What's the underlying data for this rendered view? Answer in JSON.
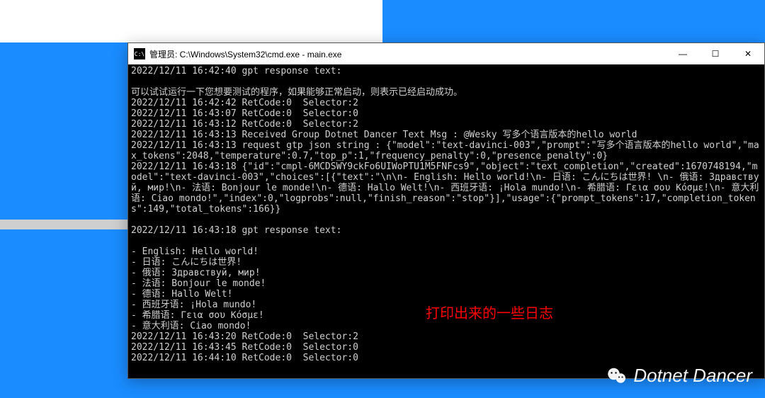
{
  "window": {
    "icon_text": "C:\\",
    "title": "管理员: C:\\Windows\\System32\\cmd.exe - main.exe",
    "controls": {
      "minimize": "—",
      "maximize": "☐",
      "close": "✕"
    }
  },
  "terminal": {
    "lines": [
      "2022/12/11 16:42:40 gpt response text:",
      "",
      "可以试试运行一下您想要测试的程序，如果能够正常启动，则表示已经启动成功。",
      "2022/12/11 16:42:42 RetCode:0  Selector:2",
      "2022/12/11 16:43:07 RetCode:0  Selector:0",
      "2022/12/11 16:43:12 RetCode:0  Selector:2",
      "2022/12/11 16:43:13 Received Group Dotnet Dancer Text Msg : @Wesky 写多个语言版本的hello world",
      "2022/12/11 16:43:13 request gtp json string : {\"model\":\"text-davinci-003\",\"prompt\":\"写多个语言版本的hello world\",\"max_tokens\":2048,\"temperature\":0.7,\"top_p\":1,\"frequency_penalty\":0,\"presence_penalty\":0}",
      "2022/12/11 16:43:18 {\"id\":\"cmpl-6MCDSWY9ckFo6UIWoPTU1M5FNFcs9\",\"object\":\"text_completion\",\"created\":1670748194,\"model\":\"text-davinci-003\",\"choices\":[{\"text\":\"\\n\\n- English: Hello world!\\n- 日语: こんにちは世界! \\n- 俄语: Здравствуй, мир!\\n- 法语: Bonjour le monde!\\n- 德语: Hallo Welt!\\n- 西班牙语: ¡Hola mundo!\\n- 希腊语: Γεια σου Κόσμε!\\n- 意大利语: Ciao mondo!\",\"index\":0,\"logprobs\":null,\"finish_reason\":\"stop\"}],\"usage\":{\"prompt_tokens\":17,\"completion_tokens\":149,\"total_tokens\":166}}",
      "",
      "2022/12/11 16:43:18 gpt response text:",
      "",
      "- English: Hello world!",
      "- 日语: こんにちは世界!",
      "- 俄语: Здравствуй, мир!",
      "- 法语: Bonjour le monde!",
      "- 德语: Hallo Welt!",
      "- 西班牙语: ¡Hola mundo!",
      "- 希腊语: Γεια σου Κόσμε!",
      "- 意大利语: Ciao mondo!",
      "2022/12/11 16:43:20 RetCode:0  Selector:2",
      "2022/12/11 16:43:45 RetCode:0  Selector:0",
      "2022/12/11 16:44:10 RetCode:0  Selector:0"
    ]
  },
  "annotation": "打印出来的一些日志",
  "watermark": "Dotnet Dancer"
}
